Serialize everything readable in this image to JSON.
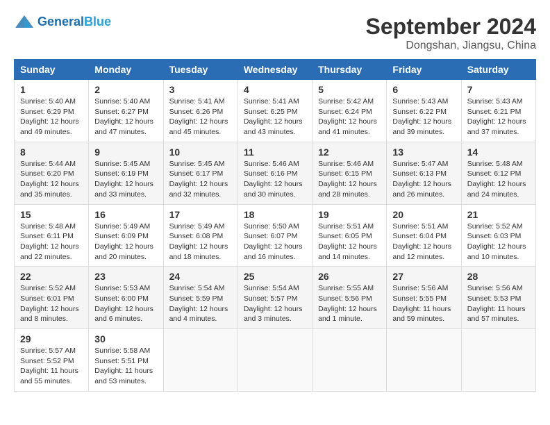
{
  "header": {
    "logo_general": "General",
    "logo_blue": "Blue",
    "month": "September 2024",
    "location": "Dongshan, Jiangsu, China"
  },
  "days_of_week": [
    "Sunday",
    "Monday",
    "Tuesday",
    "Wednesday",
    "Thursday",
    "Friday",
    "Saturday"
  ],
  "weeks": [
    [
      {
        "day": 1,
        "info": "Sunrise: 5:40 AM\nSunset: 6:29 PM\nDaylight: 12 hours\nand 49 minutes."
      },
      {
        "day": 2,
        "info": "Sunrise: 5:40 AM\nSunset: 6:27 PM\nDaylight: 12 hours\nand 47 minutes."
      },
      {
        "day": 3,
        "info": "Sunrise: 5:41 AM\nSunset: 6:26 PM\nDaylight: 12 hours\nand 45 minutes."
      },
      {
        "day": 4,
        "info": "Sunrise: 5:41 AM\nSunset: 6:25 PM\nDaylight: 12 hours\nand 43 minutes."
      },
      {
        "day": 5,
        "info": "Sunrise: 5:42 AM\nSunset: 6:24 PM\nDaylight: 12 hours\nand 41 minutes."
      },
      {
        "day": 6,
        "info": "Sunrise: 5:43 AM\nSunset: 6:22 PM\nDaylight: 12 hours\nand 39 minutes."
      },
      {
        "day": 7,
        "info": "Sunrise: 5:43 AM\nSunset: 6:21 PM\nDaylight: 12 hours\nand 37 minutes."
      }
    ],
    [
      {
        "day": 8,
        "info": "Sunrise: 5:44 AM\nSunset: 6:20 PM\nDaylight: 12 hours\nand 35 minutes."
      },
      {
        "day": 9,
        "info": "Sunrise: 5:45 AM\nSunset: 6:19 PM\nDaylight: 12 hours\nand 33 minutes."
      },
      {
        "day": 10,
        "info": "Sunrise: 5:45 AM\nSunset: 6:17 PM\nDaylight: 12 hours\nand 32 minutes."
      },
      {
        "day": 11,
        "info": "Sunrise: 5:46 AM\nSunset: 6:16 PM\nDaylight: 12 hours\nand 30 minutes."
      },
      {
        "day": 12,
        "info": "Sunrise: 5:46 AM\nSunset: 6:15 PM\nDaylight: 12 hours\nand 28 minutes."
      },
      {
        "day": 13,
        "info": "Sunrise: 5:47 AM\nSunset: 6:13 PM\nDaylight: 12 hours\nand 26 minutes."
      },
      {
        "day": 14,
        "info": "Sunrise: 5:48 AM\nSunset: 6:12 PM\nDaylight: 12 hours\nand 24 minutes."
      }
    ],
    [
      {
        "day": 15,
        "info": "Sunrise: 5:48 AM\nSunset: 6:11 PM\nDaylight: 12 hours\nand 22 minutes."
      },
      {
        "day": 16,
        "info": "Sunrise: 5:49 AM\nSunset: 6:09 PM\nDaylight: 12 hours\nand 20 minutes."
      },
      {
        "day": 17,
        "info": "Sunrise: 5:49 AM\nSunset: 6:08 PM\nDaylight: 12 hours\nand 18 minutes."
      },
      {
        "day": 18,
        "info": "Sunrise: 5:50 AM\nSunset: 6:07 PM\nDaylight: 12 hours\nand 16 minutes."
      },
      {
        "day": 19,
        "info": "Sunrise: 5:51 AM\nSunset: 6:05 PM\nDaylight: 12 hours\nand 14 minutes."
      },
      {
        "day": 20,
        "info": "Sunrise: 5:51 AM\nSunset: 6:04 PM\nDaylight: 12 hours\nand 12 minutes."
      },
      {
        "day": 21,
        "info": "Sunrise: 5:52 AM\nSunset: 6:03 PM\nDaylight: 12 hours\nand 10 minutes."
      }
    ],
    [
      {
        "day": 22,
        "info": "Sunrise: 5:52 AM\nSunset: 6:01 PM\nDaylight: 12 hours\nand 8 minutes."
      },
      {
        "day": 23,
        "info": "Sunrise: 5:53 AM\nSunset: 6:00 PM\nDaylight: 12 hours\nand 6 minutes."
      },
      {
        "day": 24,
        "info": "Sunrise: 5:54 AM\nSunset: 5:59 PM\nDaylight: 12 hours\nand 4 minutes."
      },
      {
        "day": 25,
        "info": "Sunrise: 5:54 AM\nSunset: 5:57 PM\nDaylight: 12 hours\nand 3 minutes."
      },
      {
        "day": 26,
        "info": "Sunrise: 5:55 AM\nSunset: 5:56 PM\nDaylight: 12 hours\nand 1 minute."
      },
      {
        "day": 27,
        "info": "Sunrise: 5:56 AM\nSunset: 5:55 PM\nDaylight: 11 hours\nand 59 minutes."
      },
      {
        "day": 28,
        "info": "Sunrise: 5:56 AM\nSunset: 5:53 PM\nDaylight: 11 hours\nand 57 minutes."
      }
    ],
    [
      {
        "day": 29,
        "info": "Sunrise: 5:57 AM\nSunset: 5:52 PM\nDaylight: 11 hours\nand 55 minutes."
      },
      {
        "day": 30,
        "info": "Sunrise: 5:58 AM\nSunset: 5:51 PM\nDaylight: 11 hours\nand 53 minutes."
      },
      {
        "day": null,
        "info": ""
      },
      {
        "day": null,
        "info": ""
      },
      {
        "day": null,
        "info": ""
      },
      {
        "day": null,
        "info": ""
      },
      {
        "day": null,
        "info": ""
      }
    ]
  ]
}
